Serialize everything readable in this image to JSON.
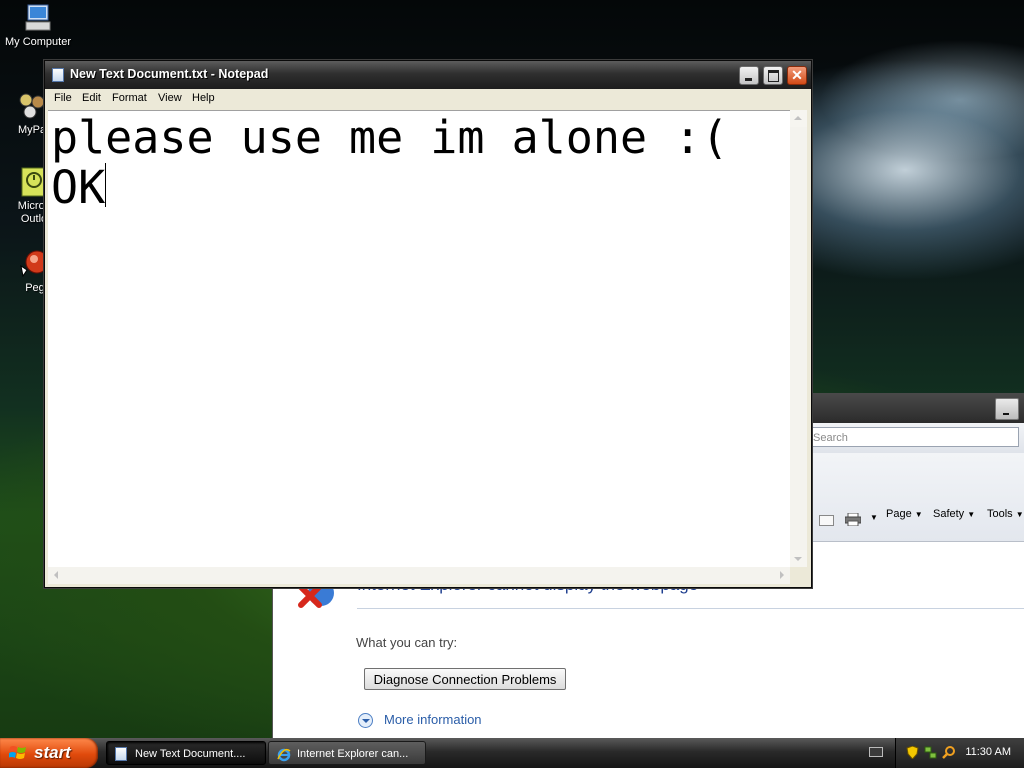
{
  "desktop": {
    "icons": [
      {
        "label": "My Computer"
      },
      {
        "label": "MyPa"
      },
      {
        "label": "Micros"
      },
      {
        "label": "Outlo"
      },
      {
        "label": "Peg"
      }
    ]
  },
  "notepad": {
    "title": "New Text Document.txt - Notepad",
    "menu": [
      "File",
      "Edit",
      "Format",
      "View",
      "Help"
    ],
    "lines": [
      "please use me im alone :(",
      "OK"
    ],
    "close_glyph": "✕"
  },
  "ie": {
    "search_placeholder": "Search",
    "commands": {
      "page": "Page",
      "safety": "Safety",
      "tools": "Tools"
    },
    "error_title": "Internet Explorer cannot display the webpage",
    "try_text": "What you can try:",
    "diagnose_button": "Diagnose Connection Problems",
    "more_info": "More information"
  },
  "taskbar": {
    "start_label": "start",
    "tasks": [
      {
        "label": "New Text Document...."
      },
      {
        "label": "Internet Explorer can..."
      }
    ],
    "clock": "11:30 AM"
  },
  "colors": {
    "start_button": "#e04a0c",
    "link_blue": "#2a5da8",
    "title_bar": "#2f2f2f"
  },
  "icon_names": [
    "my-computer-icon",
    "mypal-icon",
    "outlook-icon",
    "pegasus-icon",
    "notepad-icon",
    "ie-error-icon",
    "windows-logo-icon",
    "ie-icon",
    "keyboard-icon",
    "shield-icon",
    "network-icon",
    "search-icon"
  ]
}
